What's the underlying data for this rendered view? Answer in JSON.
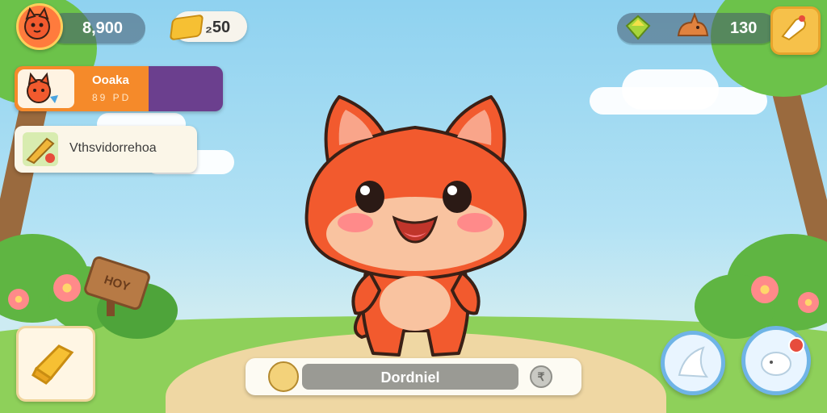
{
  "hud": {
    "coins_value": "8,900",
    "gold_value": "₂50",
    "pets_value": "130"
  },
  "quest_card": {
    "title": "Ooaka",
    "subtitle": "89 PD"
  },
  "task_card": {
    "label": "Vthsvidorrehoa"
  },
  "scene": {
    "sign_text": "HOY"
  },
  "bottom_bar": {
    "pet_name": "Dordniel",
    "coin_symbol": "₹"
  },
  "icons": {
    "player_avatar": "fox-avatar-icon",
    "gold": "gold-bar-icon",
    "gem": "green-gem-icon",
    "pet": "fox-silhouette-icon",
    "feed": "feed-bag-icon",
    "settings": "scoop-icon",
    "attack": "paw-swipe-icon",
    "profile": "pet-profile-icon"
  },
  "colors": {
    "fox_body": "#f25a2e",
    "quest_band": "#f58a2a",
    "quest_bg": "#6b3f8e",
    "button_ring": "#6fb4e6",
    "badge": "#e74c3c"
  }
}
